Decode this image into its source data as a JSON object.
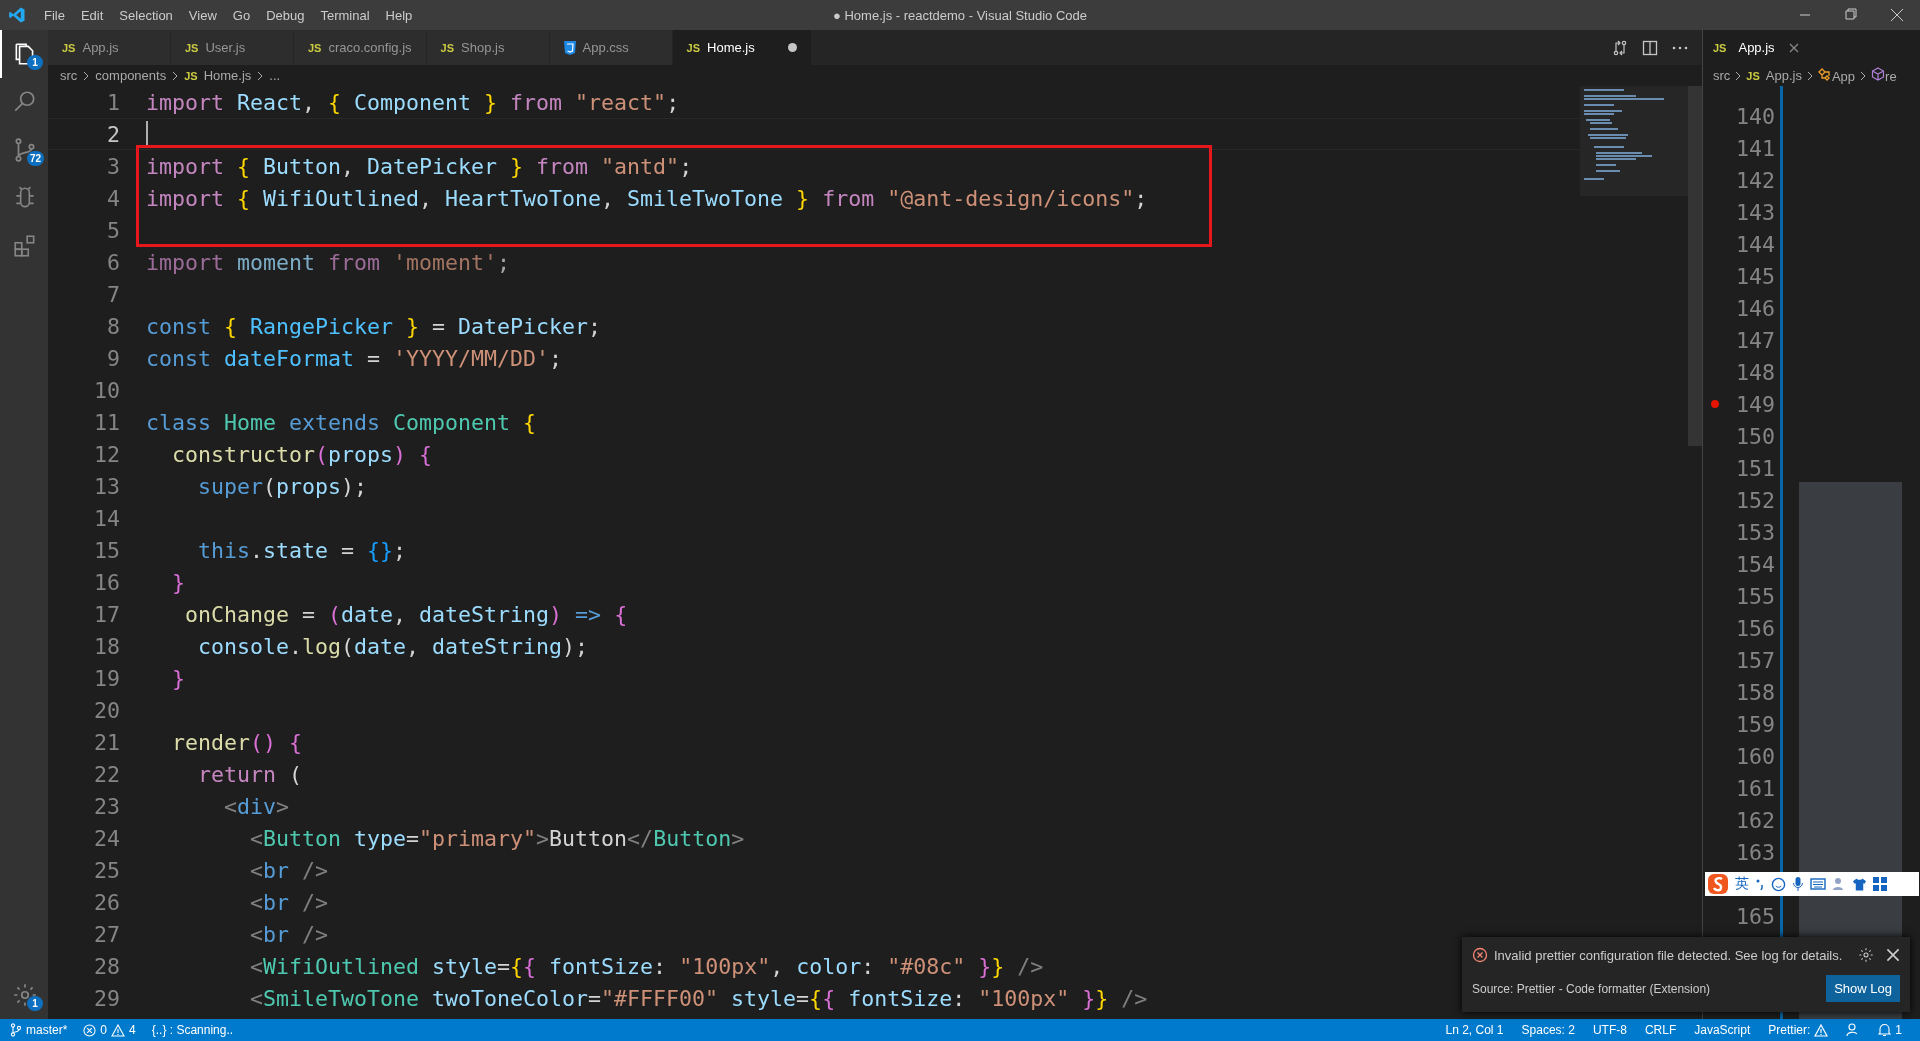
{
  "window": {
    "title": "● Home.js - reactdemo - Visual Studio Code"
  },
  "menu": [
    "File",
    "Edit",
    "Selection",
    "View",
    "Go",
    "Debug",
    "Terminal",
    "Help"
  ],
  "activity": [
    {
      "kind": "files",
      "badge": "1",
      "selected": true
    },
    {
      "kind": "search",
      "selected": false
    },
    {
      "kind": "git",
      "badge": "72",
      "selected": false
    },
    {
      "kind": "debug",
      "selected": false
    },
    {
      "kind": "extensions",
      "selected": false
    },
    {
      "kind": "settings",
      "badge": "1",
      "selected": false
    }
  ],
  "tabs": [
    {
      "kind": "js",
      "badge": "JS",
      "label": "App.js",
      "selected": false,
      "dirty": false
    },
    {
      "kind": "js",
      "badge": "JS",
      "label": "User.js",
      "selected": false,
      "dirty": false
    },
    {
      "kind": "js",
      "badge": "JS",
      "label": "craco.config.js",
      "selected": false,
      "dirty": false
    },
    {
      "kind": "js",
      "badge": "JS",
      "label": "Shop.js",
      "selected": false,
      "dirty": false
    },
    {
      "kind": "css",
      "label": "App.css",
      "selected": false,
      "dirty": false
    },
    {
      "kind": "js",
      "badge": "JS",
      "label": "Home.js",
      "selected": true,
      "dirty": true
    }
  ],
  "breadcrumb": [
    {
      "text": "src"
    },
    {
      "text": "components"
    },
    {
      "badge": "JS",
      "text": "Home.js"
    },
    {
      "text": "..."
    }
  ],
  "code": [
    {
      "number": "1",
      "current": false,
      "tokens": [
        {
          "kind": "ctl",
          "text": "import"
        },
        {
          "kind": "var",
          "text": " React"
        },
        {
          "kind": "plain",
          "text": ", "
        },
        {
          "kind": "b1",
          "text": "{"
        },
        {
          "kind": "var",
          "text": " Component "
        },
        {
          "kind": "b1",
          "text": "}"
        },
        {
          "kind": "ctl",
          "text": " from "
        },
        {
          "kind": "str",
          "text": "\"react\""
        },
        {
          "kind": "plain",
          "text": ";"
        }
      ]
    },
    {
      "number": "2",
      "current": true
    },
    {
      "number": "3",
      "current": false,
      "boxed": true,
      "tokens": [
        {
          "kind": "ctl",
          "text": "import "
        },
        {
          "kind": "b1",
          "text": "{"
        },
        {
          "kind": "var",
          "text": " Button"
        },
        {
          "kind": "plain",
          "text": ", "
        },
        {
          "kind": "var",
          "text": "DatePicker "
        },
        {
          "kind": "b1",
          "text": "}"
        },
        {
          "kind": "ctl",
          "text": " from "
        },
        {
          "kind": "str",
          "text": "\"antd\""
        },
        {
          "kind": "plain",
          "text": ";"
        }
      ]
    },
    {
      "number": "4",
      "current": false,
      "boxed": true,
      "tokens": [
        {
          "kind": "ctl",
          "text": "import "
        },
        {
          "kind": "b1",
          "text": "{"
        },
        {
          "kind": "var",
          "text": " WifiOutlined"
        },
        {
          "kind": "plain",
          "text": ", "
        },
        {
          "kind": "var",
          "text": "HeartTwoTone"
        },
        {
          "kind": "plain",
          "text": ", "
        },
        {
          "kind": "var",
          "text": "SmileTwoTone "
        },
        {
          "kind": "b1",
          "text": "}"
        },
        {
          "kind": "ctl",
          "text": " from "
        },
        {
          "kind": "str",
          "text": "\"@ant-design/icons\""
        },
        {
          "kind": "plain",
          "text": ";"
        }
      ]
    },
    {
      "number": "5",
      "current": false,
      "boxed": true
    },
    {
      "number": "6",
      "current": false,
      "unused": true,
      "tokens": [
        {
          "kind": "ctl",
          "text": "import "
        },
        {
          "kind": "var",
          "text": "moment "
        },
        {
          "kind": "ctl",
          "text": "from "
        },
        {
          "kind": "str",
          "text": "'moment'"
        },
        {
          "kind": "plain",
          "text": ";"
        }
      ]
    },
    {
      "number": "7",
      "current": false
    },
    {
      "number": "8",
      "current": false,
      "tokens": [
        {
          "kind": "kw",
          "text": "const "
        },
        {
          "kind": "b1",
          "text": "{"
        },
        {
          "kind": "cvar",
          "text": " RangePicker "
        },
        {
          "kind": "b1",
          "text": "}"
        },
        {
          "kind": "plain",
          "text": " = "
        },
        {
          "kind": "var",
          "text": "DatePicker"
        },
        {
          "kind": "plain",
          "text": ";"
        }
      ]
    },
    {
      "number": "9",
      "current": false,
      "tokens": [
        {
          "kind": "kw",
          "text": "const "
        },
        {
          "kind": "cvar",
          "text": "dateFormat"
        },
        {
          "kind": "plain",
          "text": " = "
        },
        {
          "kind": "str",
          "text": "'YYYY/MM/DD'"
        },
        {
          "kind": "plain",
          "text": ";"
        }
      ]
    },
    {
      "number": "10",
      "current": false
    },
    {
      "number": "11",
      "current": false,
      "tokens": [
        {
          "kind": "kw",
          "text": "class "
        },
        {
          "kind": "type",
          "text": "Home "
        },
        {
          "kind": "kw",
          "text": "extends "
        },
        {
          "kind": "type",
          "text": "Component "
        },
        {
          "kind": "b1",
          "text": "{"
        }
      ]
    },
    {
      "number": "12",
      "current": false,
      "tokens": [
        {
          "kind": "fn",
          "text": "  constructor"
        },
        {
          "kind": "b2",
          "text": "("
        },
        {
          "kind": "var",
          "text": "props"
        },
        {
          "kind": "b2",
          "text": ") {"
        }
      ]
    },
    {
      "number": "13",
      "current": false,
      "tokens": [
        {
          "kind": "kw",
          "text": "    super"
        },
        {
          "kind": "plain",
          "text": "("
        },
        {
          "kind": "var",
          "text": "props"
        },
        {
          "kind": "plain",
          "text": ");"
        }
      ]
    },
    {
      "number": "14",
      "current": false
    },
    {
      "number": "15",
      "current": false,
      "tokens": [
        {
          "kind": "kw",
          "text": "    this"
        },
        {
          "kind": "plain",
          "text": "."
        },
        {
          "kind": "var",
          "text": "state"
        },
        {
          "kind": "plain",
          "text": " = "
        },
        {
          "kind": "b3",
          "text": "{}"
        },
        {
          "kind": "plain",
          "text": ";"
        }
      ]
    },
    {
      "number": "16",
      "current": false,
      "tokens": [
        {
          "kind": "b2",
          "text": "  }"
        }
      ]
    },
    {
      "number": "17",
      "current": false,
      "tokens": [
        {
          "kind": "fn",
          "text": "   onChange"
        },
        {
          "kind": "plain",
          "text": " = "
        },
        {
          "kind": "b2",
          "text": "("
        },
        {
          "kind": "var",
          "text": "date"
        },
        {
          "kind": "plain",
          "text": ", "
        },
        {
          "kind": "var",
          "text": "dateString"
        },
        {
          "kind": "b2",
          "text": ")"
        },
        {
          "kind": "kw",
          "text": " => "
        },
        {
          "kind": "b2",
          "text": "{"
        }
      ]
    },
    {
      "number": "18",
      "current": false,
      "tokens": [
        {
          "kind": "var",
          "text": "    console"
        },
        {
          "kind": "plain",
          "text": "."
        },
        {
          "kind": "fn",
          "text": "log"
        },
        {
          "kind": "plain",
          "text": "("
        },
        {
          "kind": "var",
          "text": "date"
        },
        {
          "kind": "plain",
          "text": ", "
        },
        {
          "kind": "var",
          "text": "dateString"
        },
        {
          "kind": "plain",
          "text": ");"
        }
      ]
    },
    {
      "number": "19",
      "current": false,
      "tokens": [
        {
          "kind": "b2",
          "text": "  }"
        }
      ]
    },
    {
      "number": "20",
      "current": false
    },
    {
      "number": "21",
      "current": false,
      "tokens": [
        {
          "kind": "fn",
          "text": "  render"
        },
        {
          "kind": "b2",
          "text": "() {"
        }
      ]
    },
    {
      "number": "22",
      "current": false,
      "tokens": [
        {
          "kind": "ctl",
          "text": "    return"
        },
        {
          "kind": "plain",
          "text": " ("
        }
      ]
    },
    {
      "number": "23",
      "current": false,
      "tokens": [
        {
          "kind": "tag",
          "text": "      <"
        },
        {
          "kind": "kw",
          "text": "div"
        },
        {
          "kind": "tag",
          "text": ">"
        }
      ]
    },
    {
      "number": "24",
      "current": false,
      "tokens": [
        {
          "kind": "tag",
          "text": "        <"
        },
        {
          "kind": "type",
          "text": "Button"
        },
        {
          "kind": "var",
          "text": " type"
        },
        {
          "kind": "plain",
          "text": "="
        },
        {
          "kind": "str",
          "text": "\"primary\""
        },
        {
          "kind": "tag",
          "text": ">"
        },
        {
          "kind": "plain",
          "text": "Button"
        },
        {
          "kind": "tag",
          "text": "</"
        },
        {
          "kind": "type",
          "text": "Button"
        },
        {
          "kind": "tag",
          "text": ">"
        }
      ]
    },
    {
      "number": "25",
      "current": false,
      "tokens": [
        {
          "kind": "tag",
          "text": "        <"
        },
        {
          "kind": "kw",
          "text": "br"
        },
        {
          "kind": "tag",
          "text": " />"
        }
      ]
    },
    {
      "number": "26",
      "current": false,
      "tokens": [
        {
          "kind": "tag",
          "text": "        <"
        },
        {
          "kind": "kw",
          "text": "br"
        },
        {
          "kind": "tag",
          "text": " />"
        }
      ]
    },
    {
      "number": "27",
      "current": false,
      "tokens": [
        {
          "kind": "tag",
          "text": "        <"
        },
        {
          "kind": "kw",
          "text": "br"
        },
        {
          "kind": "tag",
          "text": " />"
        }
      ]
    },
    {
      "number": "28",
      "current": false,
      "tokens": [
        {
          "kind": "tag",
          "text": "        <"
        },
        {
          "kind": "type",
          "text": "WifiOutlined"
        },
        {
          "kind": "var",
          "text": " style"
        },
        {
          "kind": "plain",
          "text": "="
        },
        {
          "kind": "b1",
          "text": "{"
        },
        {
          "kind": "b2",
          "text": "{"
        },
        {
          "kind": "var",
          "text": " fontSize"
        },
        {
          "kind": "plain",
          "text": ": "
        },
        {
          "kind": "str",
          "text": "\"100px\""
        },
        {
          "kind": "plain",
          "text": ", "
        },
        {
          "kind": "var",
          "text": "color"
        },
        {
          "kind": "plain",
          "text": ": "
        },
        {
          "kind": "str",
          "text": "\"#08c\""
        },
        {
          "kind": "b2",
          "text": " }"
        },
        {
          "kind": "b1",
          "text": "}"
        },
        {
          "kind": "tag",
          "text": " />"
        }
      ]
    },
    {
      "number": "29",
      "current": false,
      "tokens": [
        {
          "kind": "tag",
          "text": "        <"
        },
        {
          "kind": "type",
          "text": "SmileTwoTone"
        },
        {
          "kind": "var",
          "text": " twoToneColor"
        },
        {
          "kind": "plain",
          "text": "="
        },
        {
          "kind": "str",
          "text": "\"#FFFF00\""
        },
        {
          "kind": "var",
          "text": " style"
        },
        {
          "kind": "plain",
          "text": "="
        },
        {
          "kind": "b1",
          "text": "{"
        },
        {
          "kind": "b2",
          "text": "{"
        },
        {
          "kind": "var",
          "text": " fontSize"
        },
        {
          "kind": "plain",
          "text": ": "
        },
        {
          "kind": "str",
          "text": "\"100px\""
        },
        {
          "kind": "b2",
          "text": " }"
        },
        {
          "kind": "b1",
          "text": "}"
        },
        {
          "kind": "tag",
          "text": " />"
        }
      ]
    }
  ],
  "side": {
    "tab": {
      "badge": "JS",
      "label": "App.js",
      "selected": true
    },
    "breadcrumb": [
      {
        "text": "src"
      },
      {
        "badge": "JS",
        "text": "App.js"
      },
      {
        "kind": "class",
        "text": "App"
      },
      {
        "kind": "method",
        "text": "re"
      }
    ],
    "lines": [
      {
        "number": "140",
        "breakpoint": false
      },
      {
        "number": "141",
        "breakpoint": false
      },
      {
        "number": "142",
        "breakpoint": false
      },
      {
        "number": "143",
        "breakpoint": false
      },
      {
        "number": "144",
        "breakpoint": false
      },
      {
        "number": "145",
        "breakpoint": false
      },
      {
        "number": "146",
        "breakpoint": false
      },
      {
        "number": "147",
        "breakpoint": false
      },
      {
        "number": "148",
        "breakpoint": false
      },
      {
        "number": "149",
        "breakpoint": true
      },
      {
        "number": "150",
        "breakpoint": false
      },
      {
        "number": "151",
        "breakpoint": false
      },
      {
        "number": "152",
        "breakpoint": false
      },
      {
        "number": "153",
        "breakpoint": false
      },
      {
        "number": "154",
        "breakpoint": false
      },
      {
        "number": "155",
        "breakpoint": false
      },
      {
        "number": "156",
        "breakpoint": false
      },
      {
        "number": "157",
        "breakpoint": false
      },
      {
        "number": "158",
        "breakpoint": false
      },
      {
        "number": "159",
        "breakpoint": false
      },
      {
        "number": "160",
        "breakpoint": false
      },
      {
        "number": "161",
        "breakpoint": false
      },
      {
        "number": "162",
        "breakpoint": false
      },
      {
        "number": "163",
        "breakpoint": false
      },
      {
        "number": "165",
        "breakpoint": false
      }
    ]
  },
  "ime_bar": {
    "label": "英"
  },
  "notification": {
    "message": "Invalid prettier configuration file detected. See log for details.",
    "source": "Source: Prettier - Code formatter (Extension)",
    "button": "Show Log"
  },
  "status_bar": {
    "branch": "master*",
    "errors": "0",
    "warnings": "4",
    "scanning": "{..} : Scanning..",
    "right": [
      {
        "kind": "text",
        "text": "Ln 2, Col 1"
      },
      {
        "kind": "text",
        "text": "Spaces: 2"
      },
      {
        "kind": "text",
        "text": "UTF-8"
      },
      {
        "kind": "text",
        "text": "CRLF"
      },
      {
        "kind": "text",
        "text": "JavaScript"
      },
      {
        "kind": "warn",
        "text": "Prettier:"
      },
      {
        "kind": "feedback"
      },
      {
        "kind": "bell",
        "text": "1"
      }
    ]
  }
}
